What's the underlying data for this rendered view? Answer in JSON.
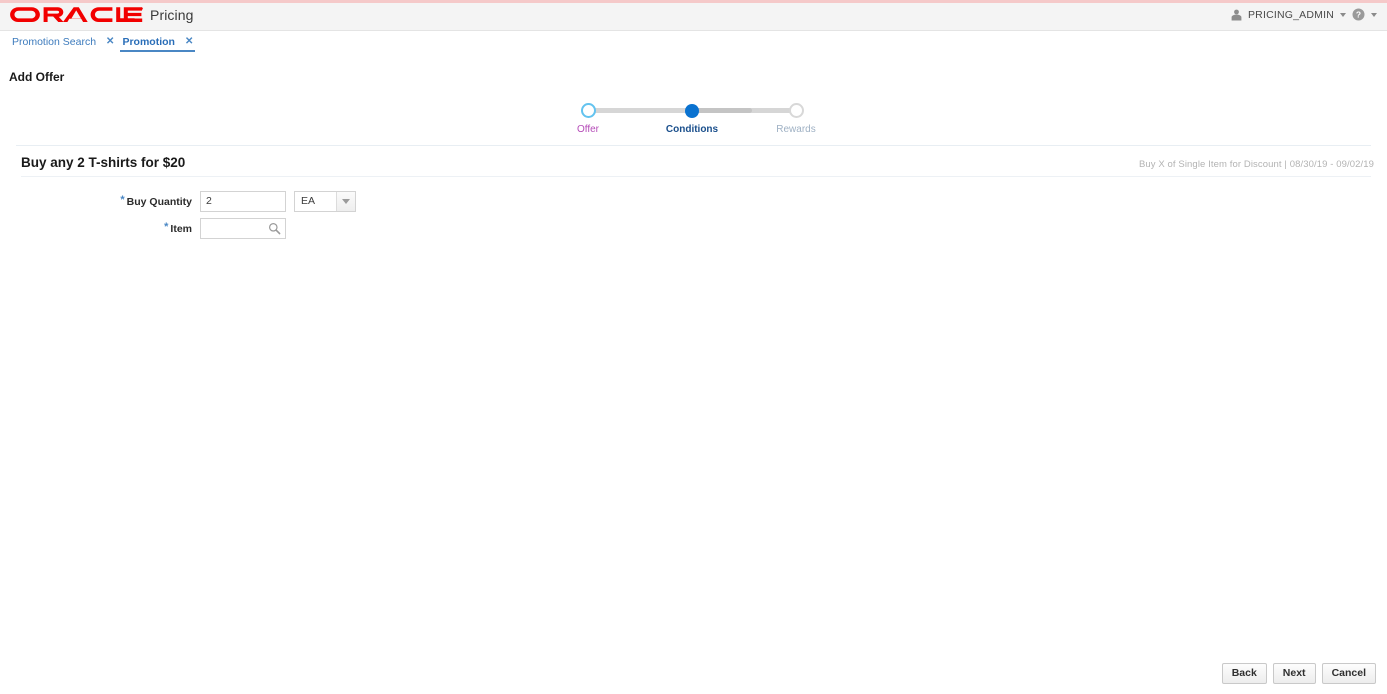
{
  "brand": {
    "logo_text": "ORACLE",
    "app_name": "Pricing",
    "logo_color": "#f20000"
  },
  "header": {
    "user_name": "PRICING_ADMIN",
    "avatar_icon": "user-avatar-icon",
    "user_menu_icon": "chevron-down-icon",
    "help_icon": "help-question-icon",
    "help_menu_icon": "chevron-down-icon"
  },
  "tabs": [
    {
      "label": "Promotion Search",
      "close": "✕",
      "active": false
    },
    {
      "label": "Promotion",
      "close": "✕",
      "active": true
    }
  ],
  "page": {
    "title": "Add Offer"
  },
  "train": {
    "steps": [
      {
        "label": "Offer",
        "state": "visited"
      },
      {
        "label": "Conditions",
        "state": "current"
      },
      {
        "label": "Rewards",
        "state": "disabled"
      }
    ]
  },
  "offer": {
    "title": "Buy any 2 T-shirts for $20",
    "meta": "Buy X of Single Item for Discount | 08/30/19 - 09/02/19"
  },
  "form": {
    "fields": [
      {
        "label": "Buy Quantity",
        "required": "*",
        "value": "2",
        "placeholder": "",
        "uom_value": "EA",
        "uom_arrow_icon": "chevron-down-icon"
      },
      {
        "label": "Item",
        "required": "*",
        "value": "",
        "placeholder": "",
        "search_icon": "magnifier-search-icon"
      }
    ]
  },
  "footer": {
    "back_label": "Back",
    "next_label": "Next",
    "cancel_label": "Cancel"
  },
  "colors": {
    "oracle_red": "#f20000",
    "accent_blue": "#0a72d0",
    "visited_purple": "#b54bb8",
    "tab_blue": "#4a87c4"
  }
}
